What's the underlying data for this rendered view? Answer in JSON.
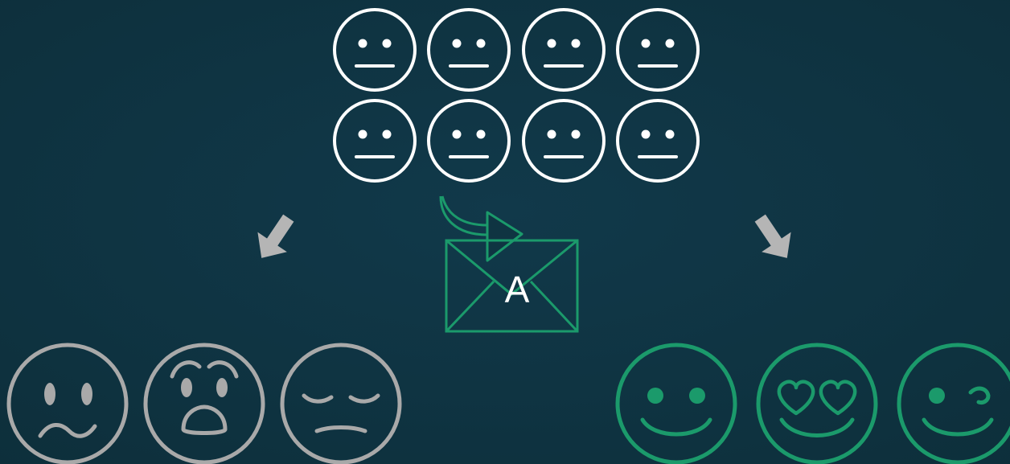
{
  "colors": {
    "background": "#0f3442",
    "neutral": "#ffffff",
    "negative": "#a9a9a9",
    "positive": "#1b9a6b"
  },
  "neutral_group": {
    "rows": 2,
    "per_row": 4,
    "icon": "neutral-face-icon"
  },
  "arrows": {
    "left": "arrow-down-left-icon",
    "right": "arrow-down-right-icon",
    "curved": "curved-arrow-icon"
  },
  "envelope": {
    "icon": "envelope-icon",
    "letter": "A"
  },
  "negative_group": {
    "icons": [
      "worried-face-icon",
      "shocked-face-icon",
      "sad-closed-eyes-face-icon"
    ]
  },
  "positive_group": {
    "icons": [
      "smiling-face-icon",
      "heart-eyes-face-icon",
      "winking-face-icon"
    ]
  }
}
